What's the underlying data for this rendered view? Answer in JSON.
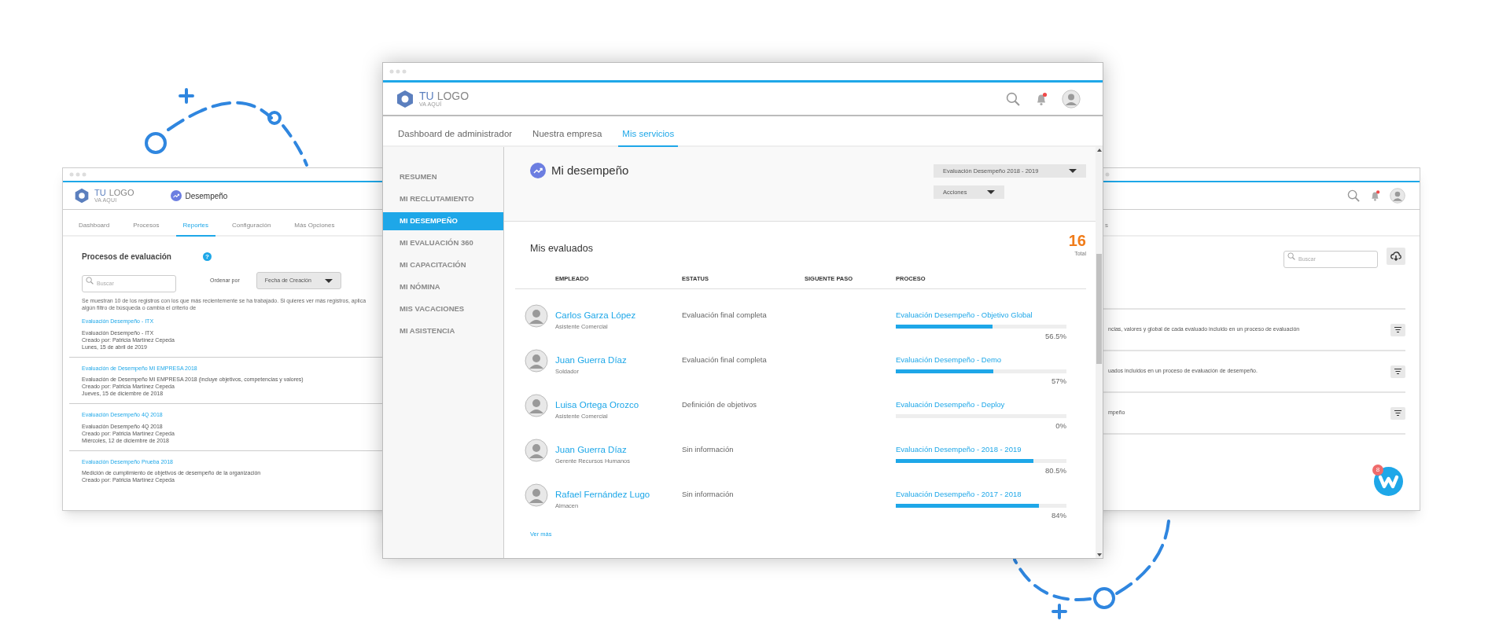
{
  "left_window": {
    "logo": {
      "primary": "TU",
      "secondary": "LOGO",
      "tagline": "VA AQUI"
    },
    "module": "Desempeño",
    "tabs": [
      {
        "label": "Dashboard",
        "selected": false
      },
      {
        "label": "Procesos",
        "selected": false
      },
      {
        "label": "Reportes",
        "selected": true
      },
      {
        "label": "Configuración",
        "selected": false
      },
      {
        "label": "Más Opciones",
        "selected": false
      }
    ],
    "heading": "Procesos de evaluación",
    "help": "?",
    "search": {
      "placeholder": "Buscar"
    },
    "sort_label": "Ordenar por",
    "sort_value": "Fecha de Creación",
    "notice": "Se muestran 10 de los registros con los que más recientemente se ha trabajado. Si quieres ver más registros, aplica algún filtro de búsqueda o cambia el criterio de",
    "processes": [
      {
        "title": "Evaluación Desempeño - ITX",
        "lines": [
          "Evaluación Desempeño - ITX",
          "Creado por: Patricia Martínez Cepeda",
          "Lunes, 15 de abril de 2019"
        ]
      },
      {
        "title": "Evaluación de Desempeño MI EMPRESA 2018",
        "lines": [
          "Evaluación de Desempeño MI EMPRESA 2018 (incluye objetivos, competencias y valores)",
          "Creado por: Patricia Martínez Cepeda",
          "Jueves, 15 de diciembre de 2018"
        ]
      },
      {
        "title": "Evaluación Desempeño 4Q 2018",
        "lines": [
          "Evaluación Desempeño 4Q 2018",
          "Creado por: Patricia Martínez Cepeda",
          "Miércoles, 12 de diciembre de 2018"
        ]
      },
      {
        "title": "Evaluación Desempeño Prueba 2018",
        "lines": [
          "Medición de cumplimiento de objetivos de desempeño de la organización",
          "Creado por: Patricia Martínez Cepeda"
        ]
      }
    ]
  },
  "center_window": {
    "logo": {
      "primary": "TU",
      "secondary": "LOGO",
      "tagline": "VA AQUÍ"
    },
    "tabs": [
      {
        "label": "Dashboard de administrador",
        "selected": false
      },
      {
        "label": "Nuestra empresa",
        "selected": false
      },
      {
        "label": "Mis servicios",
        "selected": true
      }
    ],
    "sidebar": [
      {
        "label": "RESUMEN",
        "selected": false
      },
      {
        "label": "MI RECLUTAMIENTO",
        "selected": false
      },
      {
        "label": "MI DESEMPEÑO",
        "selected": true
      },
      {
        "label": "MI EVALUACIÓN 360",
        "selected": false
      },
      {
        "label": "MI CAPACITACIÓN",
        "selected": false
      },
      {
        "label": "MI NÓMINA",
        "selected": false
      },
      {
        "label": "MIS VACACIONES",
        "selected": false
      },
      {
        "label": "MI ASISTENCIA",
        "selected": false
      }
    ],
    "page_title": "Mi desempeño",
    "process_select": "Evaluación Desempeño 2018 - 2019",
    "actions_select": "Acciones",
    "section_title": "Mis evaluados",
    "total_count": "16",
    "total_label": "Total",
    "table": {
      "columns": [
        "EMPLEADO",
        "ESTATUS",
        "SIGUENTE PASO",
        "PROCESO"
      ],
      "rows": [
        {
          "name": "Carlos Garza López",
          "role": "Asistente Comercial",
          "status": "Evaluación final completa",
          "process": "Evaluación Desempeño - Objetivo Global",
          "level": 0.565,
          "percent": "56.5%"
        },
        {
          "name": "Juan Guerra Díaz",
          "role": "Soldador",
          "status": "Evaluación final completa",
          "process": "Evaluación Desempeño - Demo",
          "level": 0.57,
          "percent": "57%"
        },
        {
          "name": "Luisa Ortega Orozco",
          "role": "Asistente Comercial",
          "status": "Definición de objetivos",
          "process": "Evaluación Desempeño - Deploy",
          "level": 0,
          "percent": "0%"
        },
        {
          "name": "Juan Guerra Díaz",
          "role": "Gerente Recursos Humanos",
          "status": "Sin información",
          "process": "Evaluación Desempeño - 2018 - 2019",
          "level": 0.805,
          "percent": "80.5%"
        },
        {
          "name": "Rafael Fernández Lugo",
          "role": "Almacen",
          "status": "Sin información",
          "process": "Evaluación Desempeño - 2017 - 2018",
          "level": 0.84,
          "percent": "84%"
        }
      ]
    },
    "more_link": "Ver más"
  },
  "right_window": {
    "tab_fragment": "s",
    "search": {
      "placeholder": "Buscar"
    },
    "rows": [
      {
        "text": "ncias, valores y global de cada evaluado incluido en un proceso de evaluación"
      },
      {
        "text": "uados incluidos en un proceso de evaluación de desempeño."
      },
      {
        "text": "mpeño"
      }
    ],
    "chat_badge": "8"
  }
}
